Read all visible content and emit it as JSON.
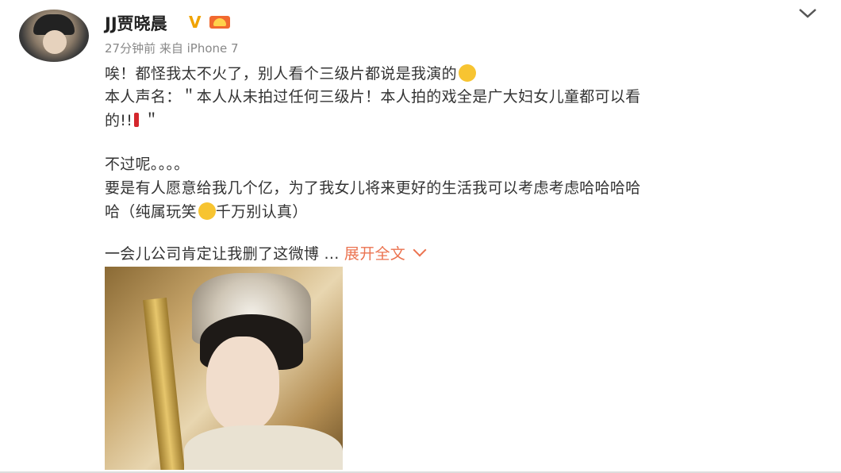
{
  "post": {
    "username": "JJ贾晓晨",
    "verified_mark": "V",
    "meta": "27分钟前 来自 iPhone 7",
    "line1": "唉！都怪我太不火了，别人看个三级片都说是我演的",
    "line2": "本人声名：＂本人从未拍过任何三级片！本人拍的戏全是广大妇女儿童都可以看",
    "line3_prefix": "的!!",
    "line3_suffix": "＂",
    "line4": "不过呢。。。。",
    "line5": "要是有人愿意给我几个亿，为了我女儿将来更好的生活我可以考虑考虑哈哈哈哈",
    "line6_prefix": "哈（纯属玩笑",
    "line6_suffix": "千万别认真）",
    "line7": "一会儿公司肯定让我删了这微博 ...",
    "expand_label": "展开全文"
  },
  "icons": {
    "chevron": "chevron-down-icon",
    "vip": "vip-crown-icon"
  },
  "colors": {
    "link": "#eb7350",
    "verified": "#f0a300",
    "meta": "#888888"
  }
}
